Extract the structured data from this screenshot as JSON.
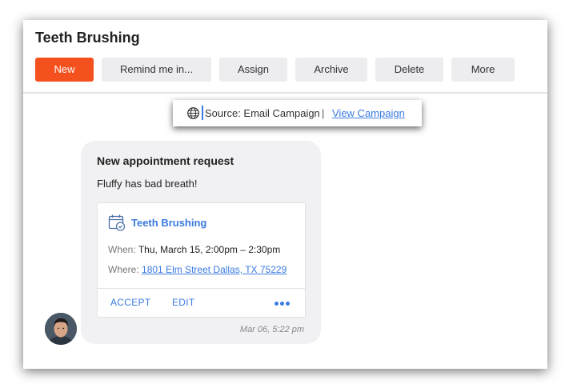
{
  "header": {
    "title": "Teeth Brushing",
    "buttons": {
      "new": "New",
      "remind": "Remind me in...",
      "assign": "Assign",
      "archive": "Archive",
      "delete": "Delete",
      "more": "More"
    }
  },
  "source": {
    "icon": "globe-icon",
    "text": "Source: Email Campaign",
    "separator": "|",
    "link": "View Campaign"
  },
  "message": {
    "heading": "New appointment request",
    "body": "Fluffy has bad breath!",
    "timestamp": "Mar 06, 5:22 pm",
    "card": {
      "icon": "calendar-check-icon",
      "title": "Teeth Brushing",
      "when_label": "When:",
      "when_value": "Thu, March 15, 2:00pm – 2:30pm",
      "where_label": "Where:",
      "where_value": "1801 Elm Street Dallas, TX 75229",
      "actions": {
        "accept": "ACCEPT",
        "edit": "EDIT",
        "more_icon": "more-horizontal-icon"
      }
    }
  },
  "colors": {
    "accent": "#f4511e",
    "link": "#3b7be0",
    "bubble": "#f1f1f3",
    "button": "#ededf0"
  }
}
